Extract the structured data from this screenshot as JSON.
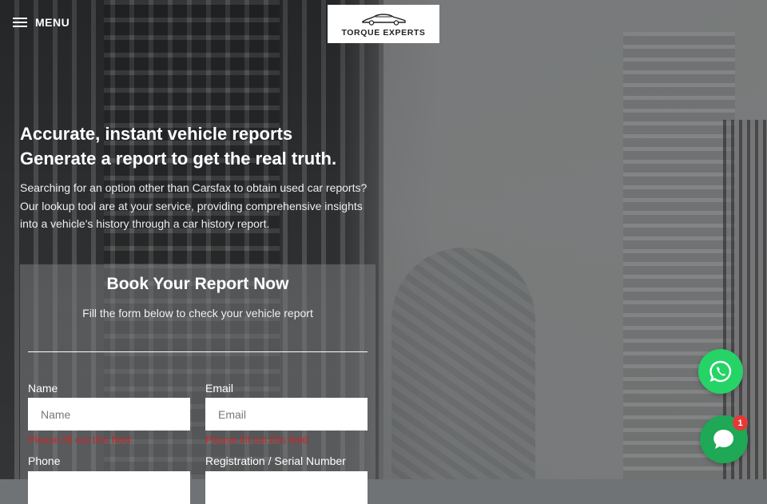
{
  "header": {
    "menu_label": "MENU",
    "logo_text": "TORQUE EXPERTS"
  },
  "hero": {
    "title_line1": "Accurate, instant vehicle reports",
    "title_line2": "Generate a report to get the real truth.",
    "description": "Searching for an option other than Carsfax to obtain used car reports? Our lookup tool are at your service, providing comprehensive insights into a vehicle's history through a car history report."
  },
  "form": {
    "title": "Book Your Report Now",
    "subtitle": "Fill the form below to check your vehicle report",
    "name_label": "Name",
    "name_placeholder": "Name",
    "email_label": "Email",
    "email_placeholder": "Email",
    "error_message": "Please fill out this field.",
    "phone_label": "Phone",
    "registration_label": "Registration / Serial Number"
  },
  "widgets": {
    "whatsapp_icon": "whatsapp-icon",
    "chat_icon": "chat-bubble-icon",
    "chat_badge": "1"
  },
  "colors": {
    "whatsapp_green": "#25d366",
    "chat_green": "#1fa855",
    "error_red": "#c62828",
    "badge_red": "#e53935"
  }
}
